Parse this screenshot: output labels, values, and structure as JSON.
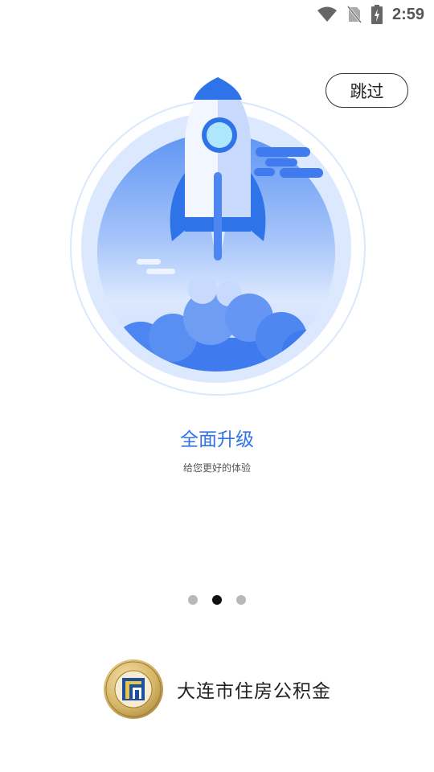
{
  "status_bar": {
    "time": "2:59",
    "icons": [
      "wifi-icon",
      "no-sim-icon",
      "battery-charging-icon"
    ]
  },
  "skip_button": {
    "label": "跳过"
  },
  "slide": {
    "title": "全面升级",
    "subtitle": "给您更好的体验",
    "illustration": "rocket-launch-illustration",
    "colors": {
      "accent": "#2f73e8",
      "light_blue": "#dbe8fd"
    }
  },
  "pager": {
    "count": 3,
    "active_index": 1
  },
  "brand": {
    "name": "大连市住房公积金",
    "logo": "housing-fund-seal-logo"
  }
}
